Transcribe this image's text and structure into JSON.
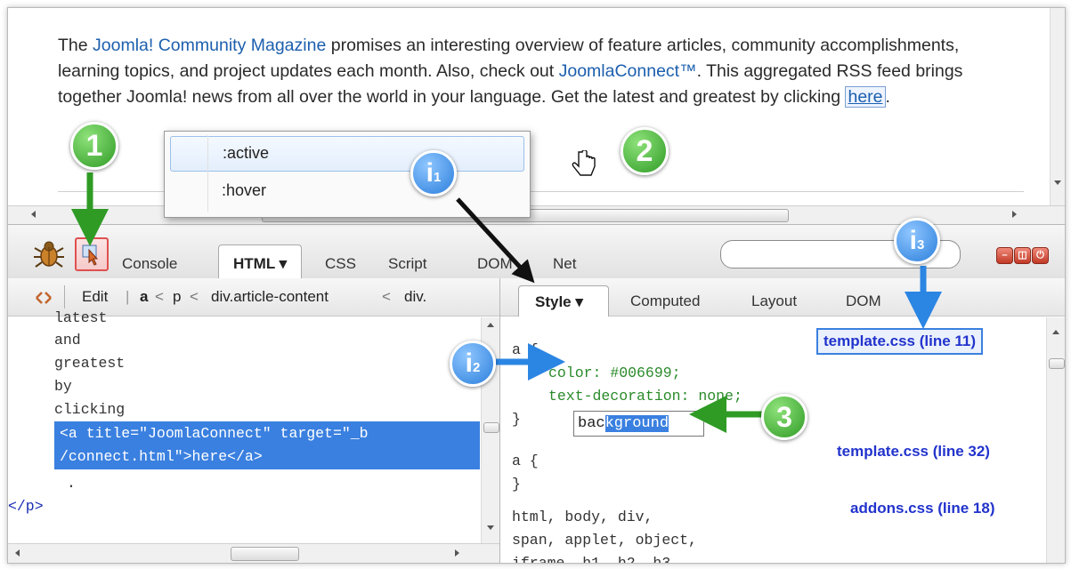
{
  "webpage": {
    "text_before_link1": "The ",
    "link_magazine": "Joomla! Community Magazine",
    "text_middle": " promises an interesting overview of feature articles, community accomplishments, learning topics, and project updates each month. Also, check out ",
    "link_connect": "JoomlaConnect™",
    "text_after_connect": ". This aggregated RSS feed brings together Joomla! news from all over the world in your language. Get the latest and greatest by clicking ",
    "link_here": "here",
    "text_end": "."
  },
  "pseudo_menu": {
    "items": [
      ":active",
      ":hover"
    ]
  },
  "toolbar": {
    "tabs": [
      "Console",
      "HTML",
      "CSS",
      "Script",
      "DOM",
      "Net"
    ],
    "html_tab_label": "HTML ▾",
    "search_placeholder": ""
  },
  "left_panel": {
    "edit_label": "Edit",
    "breadcrumb": [
      "a",
      "p",
      "div.article-content",
      "div."
    ],
    "code_lines": [
      "latest",
      "and",
      "greatest",
      "by",
      "clicking"
    ],
    "selected_line1": "<a title=\"JoomlaConnect\" target=\"_b",
    "selected_line2": "/connect.html\">here</a>",
    "dot_line": ".",
    "close_tag": "</p>"
  },
  "right_panel": {
    "tabs": [
      "Style ▾",
      "Computed",
      "Layout",
      "DOM"
    ],
    "rule1_selector": "a {",
    "rule1_prop1_name": "color",
    "rule1_prop1_value": "#006699;",
    "rule1_prop2_name": "text-decoration",
    "rule1_prop2_value": "none;",
    "rule1_close": "}",
    "rule2_selector": "a {",
    "rule2_close": "}",
    "rule3_lines": [
      "html, body, div,",
      "span, applet, object,",
      "iframe, h1, h2, h3,"
    ],
    "source_links": [
      "template.css (line 11)",
      "template.css (line 32)",
      "addons.css (line 18)"
    ],
    "autocomplete_typed": "bac",
    "autocomplete_suggest": "kground"
  },
  "callouts": {
    "c1": "1",
    "c2": "2",
    "c3": "3",
    "i1": "i",
    "i1_sub": "1",
    "i2": "i",
    "i2_sub": "2",
    "i3": "i",
    "i3_sub": "3"
  },
  "colors": {
    "selection": "#3a80e0",
    "link": "#1c5fae",
    "css_property": "#2a8a2a",
    "source_link": "#2233cc",
    "callout_green": "#2f9b25",
    "callout_blue": "#2b7fdc"
  }
}
